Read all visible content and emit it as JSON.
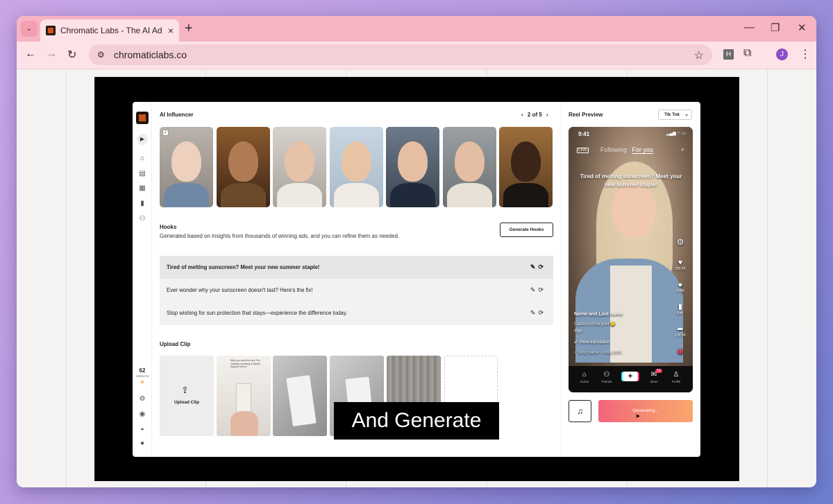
{
  "browser": {
    "tab_title": "Chromatic Labs - The AI Ad Plat",
    "new_tab": "+",
    "url": "chromaticlabs.co",
    "extension_h": "H",
    "profile_initial": "J",
    "window_controls": [
      "—",
      "❐",
      "✕"
    ]
  },
  "app": {
    "ai_influencer": {
      "title": "AI Influencer",
      "pager": "2 of 5"
    },
    "hooks": {
      "title": "Hooks",
      "subtitle": "Generated based on insights from thousands of winning ads, and you can refine them as needed.",
      "generate_button": "Generate Hooks",
      "items": [
        "Tired of melting sunscreen? Meet your new summer staple!",
        "Ever wonder why your sunscreen doesn't last? Here's the fix!",
        "Stop wishing for sun protection that stays—experience the difference today."
      ]
    },
    "upload_clip": {
      "title": "Upload Clip",
      "card_label": "Upload Clip",
      "clip1_text": "Why you need the new The Ordinary Soothing & Barrier Support Serum"
    },
    "rail": {
      "credits_value": "62",
      "credits_label": "CREDITS"
    },
    "reel_preview": {
      "title": "Reel Preview",
      "platform": "Tik Tok",
      "phone": {
        "time": "9:41",
        "tab_following": "Following",
        "tab_for_you": "For you",
        "caption": "Tired of melting sunscreen? Meet your new summer staple!",
        "name": "Name and Last name",
        "description": "Caption of the post 🙂",
        "hashtag": "#fyp",
        "translation": "Show translation",
        "music": "Song name - song artist",
        "likes": "250.5K",
        "comments": "100K",
        "saves": "89K",
        "shares": "132.5K",
        "nav": [
          "Home",
          "Friends",
          "",
          "Inbox",
          "Profile"
        ],
        "inbox_badge": "12"
      },
      "generating_label": "Generating..."
    }
  },
  "overlay": {
    "subtitle": "And Generate"
  },
  "colors": {
    "tab_bar": "#f7b4c3",
    "generate_gradient_start": "#f2657a",
    "generate_gradient_end": "#f8a76e"
  }
}
